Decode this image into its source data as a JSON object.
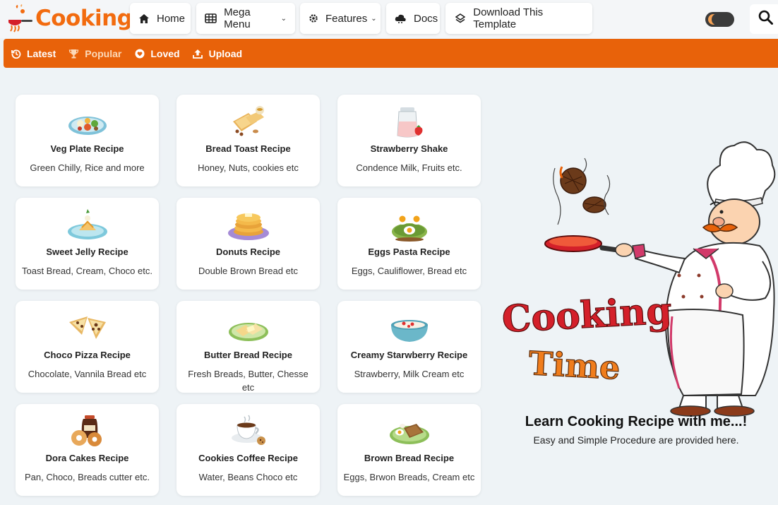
{
  "brand": {
    "name": "Cooking",
    "color": "#f26b0f"
  },
  "nav": {
    "home": "Home",
    "mega": "Mega Menu",
    "features": "Features",
    "docs": "Docs",
    "download": "Download This Template"
  },
  "subnav": {
    "latest": "Latest",
    "popular": "Popular",
    "loved": "Loved",
    "upload": "Upload",
    "color": "#e8620a"
  },
  "recipes": [
    {
      "title": "Veg Plate Recipe",
      "desc": "Green Chilly, Rice and more",
      "icon": "veg-plate-icon"
    },
    {
      "title": "Bread Toast Recipe",
      "desc": "Honey, Nuts, cookies etc",
      "icon": "bread-toast-icon"
    },
    {
      "title": "Strawberry Shake",
      "desc": "Condence Milk, Fruits etc.",
      "icon": "strawberry-shake-icon"
    },
    {
      "title": "Sweet Jelly Recipe",
      "desc": "Toast Bread, Cream, Choco etc.",
      "icon": "sweet-jelly-icon"
    },
    {
      "title": "Donuts Recipe",
      "desc": "Double Brown Bread etc",
      "icon": "pancake-icon"
    },
    {
      "title": "Eggs Pasta Recipe",
      "desc": "Eggs, Cauliflower, Bread etc",
      "icon": "egg-toast-icon"
    },
    {
      "title": "Choco Pizza Recipe",
      "desc": "Chocolate, Vannila Bread etc",
      "icon": "pizza-slice-icon"
    },
    {
      "title": "Butter Bread Recipe",
      "desc": "Fresh Breads, Butter, Chesse etc",
      "icon": "butter-bread-icon"
    },
    {
      "title": "Creamy Starwberry Recipe",
      "desc": "Strawberry, Milk Cream etc",
      "icon": "cream-bowl-icon"
    },
    {
      "title": "Dora Cakes Recipe",
      "desc": "Pan, Choco, Breads cutter etc.",
      "icon": "donut-jar-icon"
    },
    {
      "title": "Cookies Coffee Recipe",
      "desc": "Water, Beans Choco etc",
      "icon": "coffee-cup-icon"
    },
    {
      "title": "Brown Bread Recipe",
      "desc": "Eggs, Brwon Breads, Cream etc",
      "icon": "brown-bread-icon"
    }
  ],
  "hero": {
    "word1": "Cooking",
    "word2": "Time",
    "title": "Learn Cooking Recipe with me...!",
    "subtitle": "Easy and Simple Procedure are provided here."
  }
}
